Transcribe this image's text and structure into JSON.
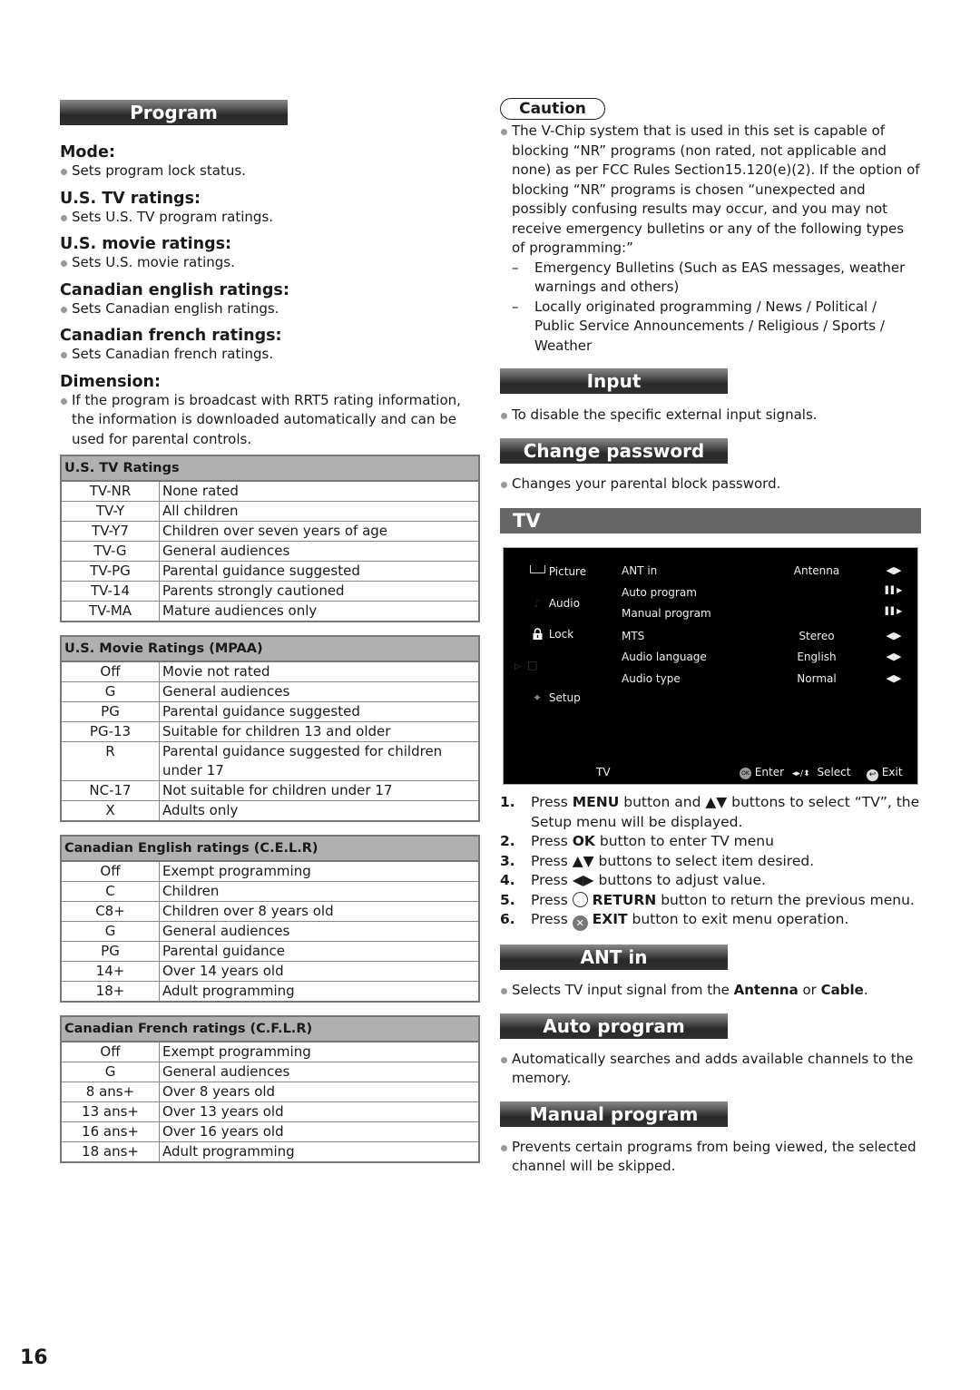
{
  "page_number": "16",
  "left": {
    "section_title": "Program",
    "items": [
      {
        "heading": "Mode:",
        "text": "Sets program lock status."
      },
      {
        "heading": "U.S. TV ratings:",
        "text": "Sets U.S. TV program ratings."
      },
      {
        "heading": "U.S. movie ratings:",
        "text": "Sets U.S. movie ratings."
      },
      {
        "heading": "Canadian english ratings:",
        "text": "Sets Canadian english ratings."
      },
      {
        "heading": "Canadian french ratings:",
        "text": "Sets Canadian french ratings."
      },
      {
        "heading": "Dimension:",
        "text": "If the program is broadcast with RRT5 rating information, the information is downloaded automatically and can be used for parental controls."
      }
    ],
    "tables": [
      {
        "title": "U.S. TV Ratings",
        "rows": [
          [
            "TV-NR",
            "None rated"
          ],
          [
            "TV-Y",
            "All children"
          ],
          [
            "TV-Y7",
            "Children over seven years of age"
          ],
          [
            "TV-G",
            "General audiences"
          ],
          [
            "TV-PG",
            "Parental guidance suggested"
          ],
          [
            "TV-14",
            "Parents strongly cautioned"
          ],
          [
            "TV-MA",
            "Mature audiences only"
          ]
        ]
      },
      {
        "title": "U.S. Movie Ratings (MPAA)",
        "rows": [
          [
            "Off",
            "Movie not rated"
          ],
          [
            "G",
            "General audiences"
          ],
          [
            "PG",
            "Parental guidance suggested"
          ],
          [
            "PG-13",
            "Suitable for children 13 and older"
          ],
          [
            "R",
            "Parental guidance suggested for children under 17"
          ],
          [
            "NC-17",
            "Not suitable for children under 17"
          ],
          [
            "X",
            "Adults only"
          ]
        ]
      },
      {
        "title": "Canadian English ratings (C.E.L.R)",
        "rows": [
          [
            "Off",
            "Exempt programming"
          ],
          [
            "C",
            "Children"
          ],
          [
            "C8+",
            "Children over 8 years old"
          ],
          [
            "G",
            "General audiences"
          ],
          [
            "PG",
            "Parental guidance"
          ],
          [
            "14+",
            "Over 14 years old"
          ],
          [
            "18+",
            "Adult programming"
          ]
        ]
      },
      {
        "title": "Canadian French ratings (C.F.L.R)",
        "rows": [
          [
            "Off",
            "Exempt programming"
          ],
          [
            "G",
            "General audiences"
          ],
          [
            "8 ans+",
            "Over 8 years old"
          ],
          [
            "13 ans+",
            "Over 13 years old"
          ],
          [
            "16 ans+",
            "Over 16 years old"
          ],
          [
            "18 ans+",
            "Adult programming"
          ]
        ]
      }
    ]
  },
  "right": {
    "caution": {
      "label": "Caution",
      "text": "The V-Chip system that is used in this set is capable of blocking “NR” programs (non rated, not applicable and none) as per FCC Rules Section15.120(e)(2). If the option of blocking “NR” programs is chosen “unexpected and possibly confusing results may occur, and you may not receive emergency bulletins or any of the following types of programming:”",
      "sub_items": [
        "Emergency Bulletins (Such as EAS messages, weather warnings and others)",
        "Locally originated programming / News / Political / Public Service Announcements / Religious / Sports / Weather"
      ],
      "dash": "–"
    },
    "input": {
      "title": "Input",
      "text": "To disable the specific external input signals."
    },
    "change_password": {
      "title": "Change password",
      "text": "Changes your parental block password."
    },
    "tv": {
      "title": "TV",
      "screen": {
        "sidebar": [
          {
            "label": "Picture",
            "icon": "picture-icon"
          },
          {
            "label": "Audio",
            "icon": "audio-icon"
          },
          {
            "label": "Lock",
            "icon": "lock-icon"
          },
          {
            "label": "",
            "icon": "tv-icon"
          },
          {
            "label": "Setup",
            "icon": "setup-icon"
          }
        ],
        "rows": [
          {
            "label": "ANT in",
            "value": "Antenna",
            "arrow": "◀▶"
          },
          {
            "label": "Auto program",
            "value": "",
            "arrow": "▌▌▶"
          },
          {
            "label": "Manual program",
            "value": "",
            "arrow": "▌▌▶"
          },
          {
            "label": "MTS",
            "value": "Stereo",
            "arrow": "◀▶"
          },
          {
            "label": "Audio language",
            "value": "English",
            "arrow": "◀▶"
          },
          {
            "label": "Audio type",
            "value": "Normal",
            "arrow": "◀▶"
          }
        ],
        "footer": {
          "menu_name": "TV",
          "enter_label": "Enter",
          "select_label": "Select",
          "exit_label": "Exit",
          "ok_glyph": "OK",
          "select_glyph": "◂▸/⬍"
        }
      },
      "steps": [
        {
          "num": "1.",
          "pre": "Press ",
          "bold": "MENU",
          "post": " button and ▲▼ buttons to select “TV”, the Setup menu will be displayed."
        },
        {
          "num": "2.",
          "pre": "Press ",
          "bold": "OK",
          "post": " button to enter TV menu"
        },
        {
          "num": "3.",
          "pre": "Press ▲▼ buttons to select item desired.",
          "bold": "",
          "post": ""
        },
        {
          "num": "4.",
          "pre": "Press ◀▶ buttons to adjust value.",
          "bold": "",
          "post": ""
        },
        {
          "num": "5.",
          "pre": "Press ",
          "bold": "RETURN",
          "post": " button to return the previous menu."
        },
        {
          "num": "6.",
          "pre": "Press ",
          "bold": "EXIT",
          "post": " button to exit menu operation."
        }
      ]
    },
    "ant_in": {
      "title": "ANT in",
      "text_pre": "Selects TV input signal from the ",
      "bold1": "Antenna",
      "mid": " or ",
      "bold2": "Cable",
      "end": "."
    },
    "auto_program": {
      "title": "Auto program",
      "text": "Automatically searches and adds available channels to the memory."
    },
    "manual_program": {
      "title": "Manual program",
      "text": "Prevents certain programs from being viewed, the selected channel will be skipped."
    }
  }
}
